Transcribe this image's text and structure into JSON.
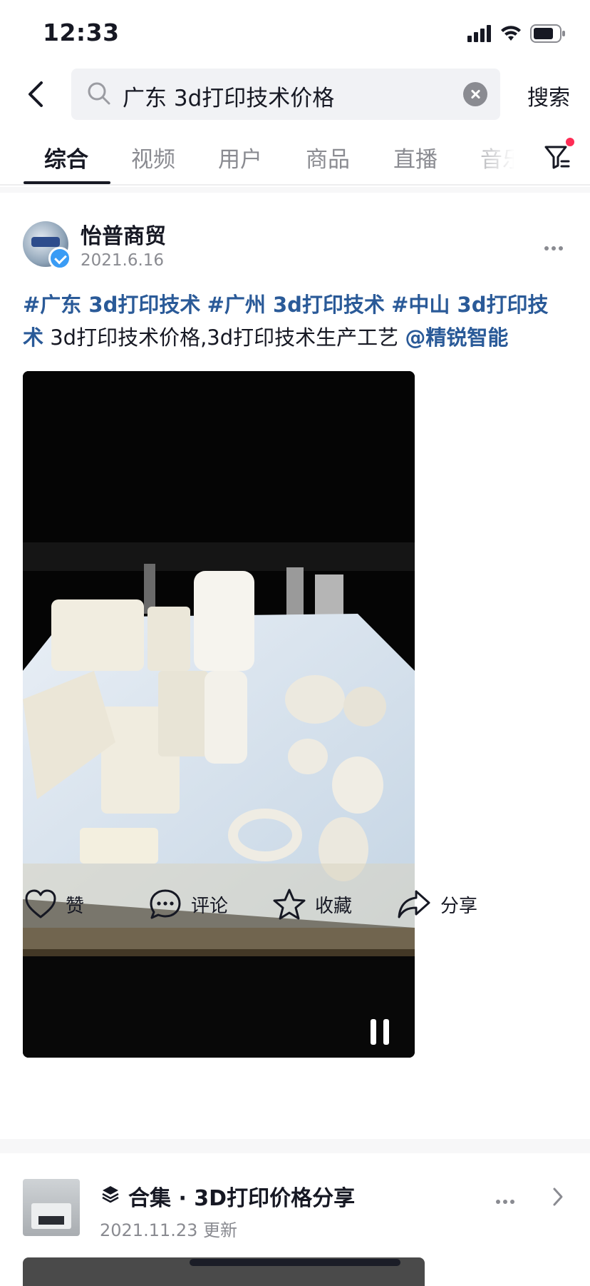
{
  "status_bar": {
    "time": "12:33"
  },
  "search": {
    "query": "广东 3d打印技术价格",
    "submit_label": "搜索"
  },
  "tabs": [
    {
      "label": "综合",
      "active": true
    },
    {
      "label": "视频"
    },
    {
      "label": "用户"
    },
    {
      "label": "商品"
    },
    {
      "label": "直播"
    },
    {
      "label": "音乐"
    }
  ],
  "post": {
    "author": "怡普商贸",
    "date": "2021.6.16",
    "caption": {
      "hashtags": [
        "#广东 3d打印技术",
        "#广州 3d打印技术",
        "#中山 3d打印技术"
      ],
      "text": " 3d打印技术价格,3d打印技术生产工艺",
      "mention": "@精锐智能"
    },
    "actions": {
      "like": "赞",
      "comment": "评论",
      "favorite": "收藏",
      "share": "分享"
    }
  },
  "collection": {
    "prefix": "合集 · ",
    "title": "3D打印价格分享",
    "date": "2021.11.23 更新"
  },
  "colors": {
    "hashtag": "#2a5a98",
    "secondary_text": "#8a8b91",
    "badge": "#fe2c55",
    "verified": "#3a9cf5"
  }
}
